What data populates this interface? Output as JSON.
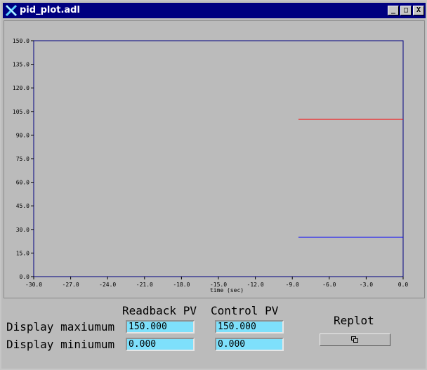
{
  "window": {
    "title": "pid_plot.adl"
  },
  "titlebar_buttons": {
    "minimize": "_",
    "maximize": "□",
    "close": "X"
  },
  "chart_data": {
    "type": "line",
    "title": "",
    "xlabel": "time (sec)",
    "ylabel": "",
    "xlim": [
      -30.0,
      0.0
    ],
    "ylim": [
      0.0,
      150.0
    ],
    "x_ticks": [
      "-30.0",
      "-27.0",
      "-24.0",
      "-21.0",
      "-18.0",
      "-15.0",
      "-12.0",
      "-9.0",
      "-6.0",
      "-3.0",
      "0.0"
    ],
    "x_tick_values": [
      -30,
      -27,
      -24,
      -21,
      -18,
      -15,
      -12,
      -9,
      -6,
      -3,
      0
    ],
    "y_ticks": [
      "150.0",
      "135.0",
      "120.0",
      "105.0",
      "90.0",
      "75.0",
      "60.0",
      "45.0",
      "30.0",
      "15.0",
      "0.0"
    ],
    "y_tick_values": [
      150,
      135,
      120,
      105,
      90,
      75,
      60,
      45,
      30,
      15,
      0
    ],
    "grid": false,
    "series": [
      {
        "color": "#ff0000",
        "x": [
          -8.5,
          0.0
        ],
        "y": [
          100.0,
          100.0
        ]
      },
      {
        "color": "#0000ff",
        "x": [
          -8.5,
          0.0
        ],
        "y": [
          25.0,
          25.0
        ]
      }
    ]
  },
  "panel": {
    "col_readback": "Readback PV",
    "col_control": "Control PV",
    "row_max": "Display maxiumum",
    "row_min": "Display miniumum",
    "readback_max": "150.000",
    "readback_min": "0.000",
    "control_max": "150.000",
    "control_min": "0.000",
    "replot_label": "Replot"
  }
}
